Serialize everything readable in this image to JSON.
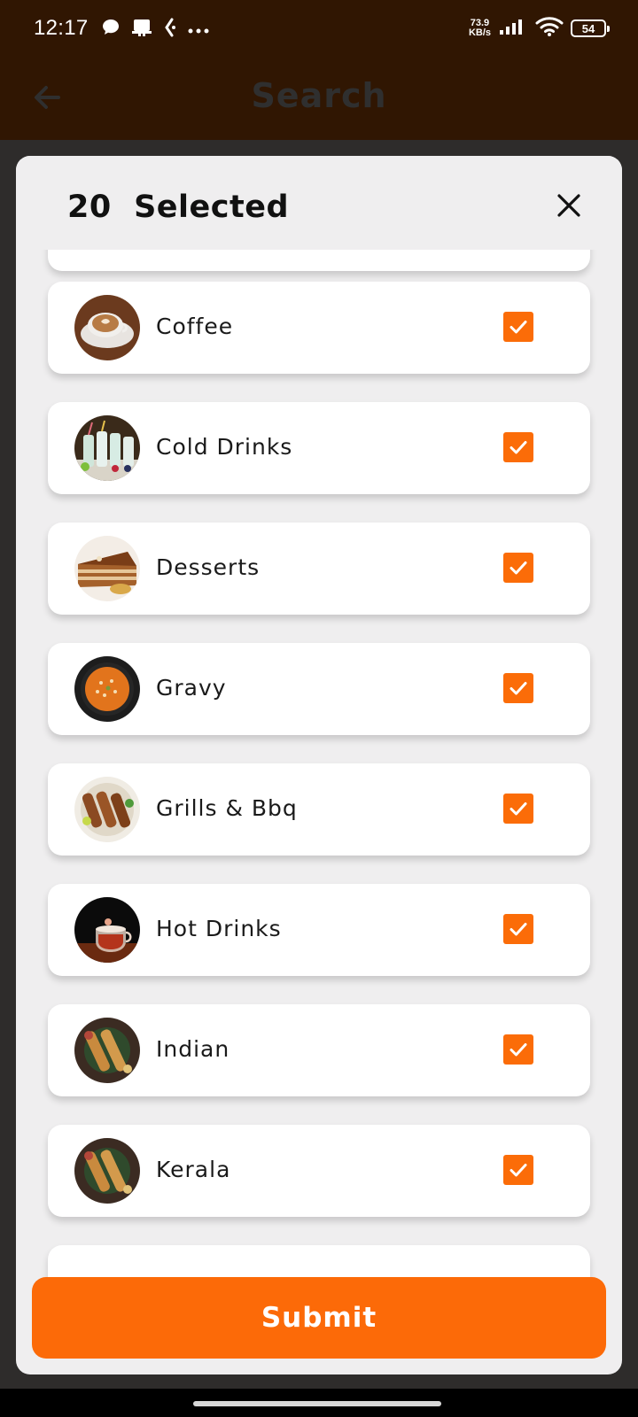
{
  "status_bar": {
    "time": "12:17",
    "net_speed_value": "73.9",
    "net_speed_unit": "KB/s",
    "battery": "54",
    "left_icons": [
      "chat-icon",
      "cast-icon",
      "app-notification-icon",
      "more-dots-icon"
    ],
    "right_icons": [
      "signal-icon",
      "wifi-icon",
      "battery-icon"
    ]
  },
  "app_bar": {
    "title": "Search",
    "back_icon": "arrow-left-icon"
  },
  "sheet": {
    "selected_count": "20",
    "selected_label": "Selected",
    "close_icon": "close-icon",
    "items": [
      {
        "label": "",
        "checked": true
      },
      {
        "label": "Coffee",
        "checked": true,
        "thumb": "coffee"
      },
      {
        "label": "Cold Drinks",
        "checked": true,
        "thumb": "cold-drinks"
      },
      {
        "label": "Desserts",
        "checked": true,
        "thumb": "desserts"
      },
      {
        "label": "Gravy",
        "checked": true,
        "thumb": "gravy"
      },
      {
        "label": "Grills & Bbq",
        "checked": true,
        "thumb": "grills"
      },
      {
        "label": "Hot Drinks",
        "checked": true,
        "thumb": "hot-drinks"
      },
      {
        "label": "Indian",
        "checked": true,
        "thumb": "indian"
      },
      {
        "label": "Kerala",
        "checked": true,
        "thumb": "kerala"
      }
    ],
    "submit_label": "Submit"
  },
  "colors": {
    "status_bar_bg": "#301602",
    "accent": "#fc6a08",
    "sheet_bg": "#efeeef",
    "card_bg": "#ffffff",
    "dim_bg": "#2e2c2b"
  }
}
